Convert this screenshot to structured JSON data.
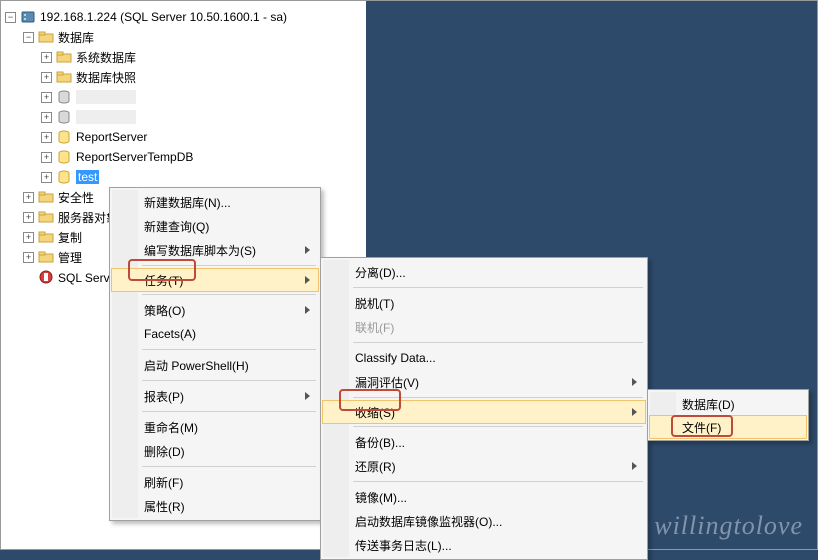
{
  "server": {
    "label": "192.168.1.224 (SQL Server 10.50.1600.1 - sa)"
  },
  "tree": {
    "databases": "数据库",
    "sysdb": "系统数据库",
    "dbsnap": "数据库快照",
    "blankdb": "",
    "reportserver": "ReportServer",
    "reportservertemp": "ReportServerTempDB",
    "test": "test",
    "security": "安全性",
    "serverobj": "服务器对象",
    "replication": "复制",
    "mgmt": "管理",
    "sqlagent": "SQL Server 代理"
  },
  "menu1": {
    "newdb": "新建数据库(N)...",
    "newquery": "新建查询(Q)",
    "script": "编写数据库脚本为(S)",
    "tasks": "任务(T)",
    "policy": "策略(O)",
    "facets": "Facets(A)",
    "powershell": "启动 PowerShell(H)",
    "reports": "报表(P)",
    "rename": "重命名(M)",
    "delete": "删除(D)",
    "refresh": "刷新(F)",
    "props": "属性(R)"
  },
  "menu2": {
    "detach": "分离(D)...",
    "offline": "脱机(T)",
    "online": "联机(F)",
    "classify": "Classify Data...",
    "vuln": "漏洞评估(V)",
    "shrink": "收缩(S)",
    "backup": "备份(B)...",
    "restore": "还原(R)",
    "mirror": "镜像(M)...",
    "mirrormon": "启动数据库镜像监视器(O)...",
    "shiplog": "传送事务日志(L)..."
  },
  "menu3": {
    "database": "数据库(D)",
    "file": "文件(F)"
  },
  "watermark": "willingtolove"
}
